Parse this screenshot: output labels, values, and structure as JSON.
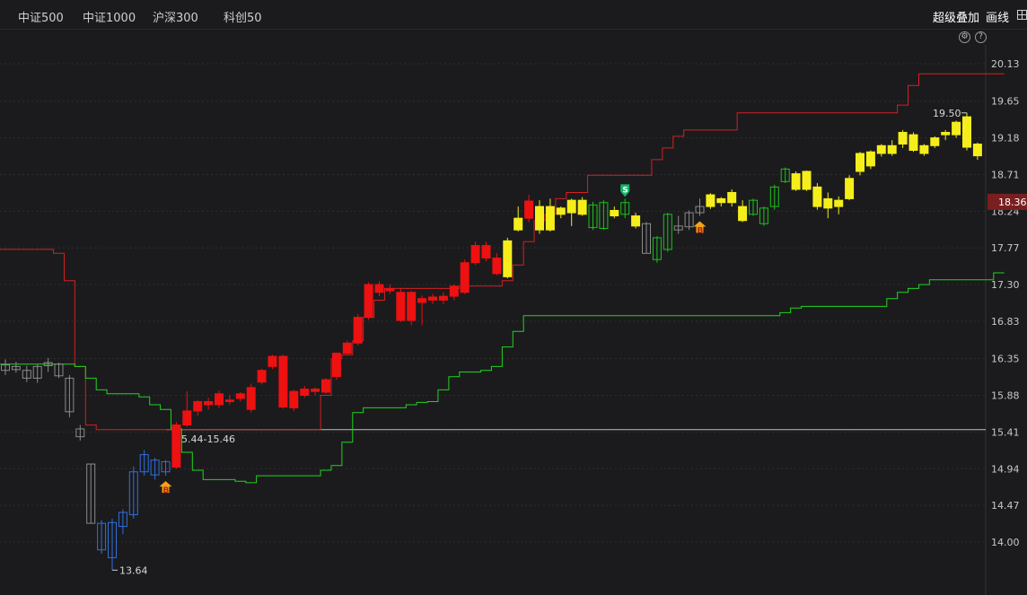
{
  "toolbar": {
    "tabs": [
      "中证500",
      "中证1000",
      "沪深300",
      "科创50"
    ],
    "overlay_label": "超级叠加",
    "draw_label": "画线"
  },
  "colors": {
    "background": "#1b1b1d",
    "up_red": "#ee1111",
    "yellow": "#f5ee1b",
    "green": "#18c418",
    "blue": "#2f6fe0",
    "gray": "#8a8a8a",
    "upper_band": "#d42020",
    "lower_band": "#1fd41f",
    "price_tag": "#7a1f1f"
  },
  "chart_data": {
    "type": "candlestick",
    "y_ticks": [
      "20.13",
      "19.65",
      "19.18",
      "18.71",
      "18.24",
      "17.77",
      "17.30",
      "16.83",
      "16.35",
      "15.88",
      "15.41",
      "14.94",
      "14.47",
      "14.00"
    ],
    "ylim": [
      13.55,
      20.25
    ],
    "current_price": "18.36",
    "reference_line": 15.44,
    "reference_label": "15.44-15.46",
    "max_label": "19.50",
    "max_value": 19.5,
    "min_label": "13.64",
    "min_value": 13.64,
    "candles": [
      {
        "o": 16.2,
        "h": 16.34,
        "l": 16.14,
        "c": 16.27,
        "s": "gray",
        "f": 0
      },
      {
        "o": 16.25,
        "h": 16.31,
        "l": 16.17,
        "c": 16.21,
        "s": "gray",
        "f": 0
      },
      {
        "o": 16.2,
        "h": 16.26,
        "l": 16.05,
        "c": 16.1,
        "s": "gray",
        "f": 0
      },
      {
        "o": 16.1,
        "h": 16.28,
        "l": 16.04,
        "c": 16.25,
        "s": "gray",
        "f": 0
      },
      {
        "o": 16.26,
        "h": 16.36,
        "l": 16.18,
        "c": 16.3,
        "s": "gray",
        "f": 0
      },
      {
        "o": 16.28,
        "h": 16.3,
        "l": 16.1,
        "c": 16.13,
        "s": "gray",
        "f": 0
      },
      {
        "o": 16.1,
        "h": 16.14,
        "l": 15.6,
        "c": 15.67,
        "s": "gray",
        "f": 0
      },
      {
        "o": 15.45,
        "h": 15.5,
        "l": 15.3,
        "c": 15.35,
        "s": "gray",
        "f": 0
      },
      {
        "o": 15.0,
        "h": 15.0,
        "l": 14.24,
        "c": 14.24,
        "s": "gray",
        "f": 0
      },
      {
        "o": 14.24,
        "h": 14.28,
        "l": 13.85,
        "c": 13.9,
        "s": "blue",
        "f": 0
      },
      {
        "o": 13.8,
        "h": 14.3,
        "l": 13.64,
        "c": 14.25,
        "s": "blue",
        "f": 0
      },
      {
        "o": 14.2,
        "h": 14.42,
        "l": 14.1,
        "c": 14.38,
        "s": "blue",
        "f": 0
      },
      {
        "o": 14.35,
        "h": 14.97,
        "l": 14.3,
        "c": 14.9,
        "s": "blue",
        "f": 0
      },
      {
        "o": 14.9,
        "h": 15.18,
        "l": 14.85,
        "c": 15.12,
        "s": "blue",
        "f": 0
      },
      {
        "o": 15.05,
        "h": 15.08,
        "l": 14.8,
        "c": 14.86,
        "s": "blue",
        "f": 0
      },
      {
        "o": 14.9,
        "h": 15.05,
        "l": 14.85,
        "c": 15.03,
        "s": "blue",
        "f": 0
      },
      {
        "o": 14.96,
        "h": 15.54,
        "l": 14.94,
        "c": 15.5,
        "s": "red",
        "f": 1
      },
      {
        "o": 15.5,
        "h": 15.93,
        "l": 15.48,
        "c": 15.68,
        "s": "red",
        "f": 1
      },
      {
        "o": 15.68,
        "h": 15.82,
        "l": 15.62,
        "c": 15.8,
        "s": "red",
        "f": 1
      },
      {
        "o": 15.8,
        "h": 15.85,
        "l": 15.7,
        "c": 15.76,
        "s": "red",
        "f": 1
      },
      {
        "o": 15.76,
        "h": 15.94,
        "l": 15.72,
        "c": 15.9,
        "s": "red",
        "f": 1
      },
      {
        "o": 15.82,
        "h": 15.88,
        "l": 15.76,
        "c": 15.8,
        "s": "red",
        "f": 1
      },
      {
        "o": 15.84,
        "h": 15.92,
        "l": 15.8,
        "c": 15.9,
        "s": "red",
        "f": 1
      },
      {
        "o": 15.7,
        "h": 16.03,
        "l": 15.66,
        "c": 15.98,
        "s": "red",
        "f": 1
      },
      {
        "o": 16.05,
        "h": 16.22,
        "l": 16.02,
        "c": 16.2,
        "s": "red",
        "f": 1
      },
      {
        "o": 16.25,
        "h": 16.4,
        "l": 16.22,
        "c": 16.38,
        "s": "red",
        "f": 1
      },
      {
        "o": 16.38,
        "h": 16.4,
        "l": 15.71,
        "c": 15.73,
        "s": "red",
        "f": 1
      },
      {
        "o": 15.72,
        "h": 15.95,
        "l": 15.68,
        "c": 15.93,
        "s": "red",
        "f": 1
      },
      {
        "o": 15.88,
        "h": 16.0,
        "l": 15.85,
        "c": 15.96,
        "s": "red",
        "f": 1
      },
      {
        "o": 15.93,
        "h": 15.98,
        "l": 15.88,
        "c": 15.96,
        "s": "red",
        "f": 1
      },
      {
        "o": 15.92,
        "h": 16.1,
        "l": 15.9,
        "c": 16.08,
        "s": "red",
        "f": 1
      },
      {
        "o": 16.12,
        "h": 16.43,
        "l": 16.08,
        "c": 16.42,
        "s": "red",
        "f": 1
      },
      {
        "o": 16.42,
        "h": 16.58,
        "l": 16.4,
        "c": 16.55,
        "s": "red",
        "f": 1
      },
      {
        "o": 16.55,
        "h": 16.92,
        "l": 16.52,
        "c": 16.88,
        "s": "red",
        "f": 1
      },
      {
        "o": 16.88,
        "h": 17.33,
        "l": 16.85,
        "c": 17.3,
        "s": "red",
        "f": 1
      },
      {
        "o": 17.2,
        "h": 17.34,
        "l": 17.15,
        "c": 17.3,
        "s": "red",
        "f": 1
      },
      {
        "o": 17.25,
        "h": 17.3,
        "l": 17.18,
        "c": 17.22,
        "s": "red",
        "f": 1
      },
      {
        "o": 17.2,
        "h": 17.25,
        "l": 16.82,
        "c": 16.84,
        "s": "red",
        "f": 1
      },
      {
        "o": 16.84,
        "h": 17.22,
        "l": 16.78,
        "c": 17.2,
        "s": "red",
        "f": 1
      },
      {
        "o": 17.07,
        "h": 17.16,
        "l": 16.78,
        "c": 17.12,
        "s": "red",
        "f": 1
      },
      {
        "o": 17.1,
        "h": 17.18,
        "l": 17.05,
        "c": 17.14,
        "s": "red",
        "f": 1
      },
      {
        "o": 17.1,
        "h": 17.2,
        "l": 17.05,
        "c": 17.15,
        "s": "red",
        "f": 1
      },
      {
        "o": 17.15,
        "h": 17.3,
        "l": 17.1,
        "c": 17.28,
        "s": "red",
        "f": 1
      },
      {
        "o": 17.2,
        "h": 17.62,
        "l": 17.18,
        "c": 17.58,
        "s": "red",
        "f": 1
      },
      {
        "o": 17.58,
        "h": 17.85,
        "l": 17.55,
        "c": 17.8,
        "s": "red",
        "f": 1
      },
      {
        "o": 17.8,
        "h": 17.85,
        "l": 17.6,
        "c": 17.64,
        "s": "red",
        "f": 1
      },
      {
        "o": 17.64,
        "h": 17.7,
        "l": 17.42,
        "c": 17.44,
        "s": "red",
        "f": 1
      },
      {
        "o": 17.4,
        "h": 17.9,
        "l": 17.38,
        "c": 17.86,
        "s": "yellow",
        "f": 1
      },
      {
        "o": 18.0,
        "h": 18.3,
        "l": 17.98,
        "c": 18.15,
        "s": "yellow",
        "f": 1
      },
      {
        "o": 18.15,
        "h": 18.45,
        "l": 18.1,
        "c": 18.37,
        "s": "red",
        "f": 1
      },
      {
        "o": 18.3,
        "h": 18.38,
        "l": 17.95,
        "c": 18.0,
        "s": "yellow",
        "f": 1
      },
      {
        "o": 18.3,
        "h": 18.4,
        "l": 17.98,
        "c": 18.0,
        "s": "yellow",
        "f": 1
      },
      {
        "o": 18.2,
        "h": 18.3,
        "l": 18.15,
        "c": 18.28,
        "s": "yellow",
        "f": 1
      },
      {
        "o": 18.22,
        "h": 18.4,
        "l": 18.05,
        "c": 18.38,
        "s": "yellow",
        "f": 1
      },
      {
        "o": 18.38,
        "h": 18.42,
        "l": 18.18,
        "c": 18.2,
        "s": "yellow",
        "f": 1
      },
      {
        "o": 18.32,
        "h": 18.36,
        "l": 18.0,
        "c": 18.03,
        "s": "green",
        "f": 0
      },
      {
        "o": 18.35,
        "h": 18.38,
        "l": 18.0,
        "c": 18.02,
        "s": "green",
        "f": 0
      },
      {
        "o": 18.18,
        "h": 18.3,
        "l": 18.15,
        "c": 18.25,
        "s": "yellow",
        "f": 1
      },
      {
        "o": 18.2,
        "h": 18.4,
        "l": 18.15,
        "c": 18.35,
        "s": "green",
        "f": 0
      },
      {
        "o": 18.18,
        "h": 18.22,
        "l": 18.02,
        "c": 18.05,
        "s": "yellow",
        "f": 1
      },
      {
        "o": 18.08,
        "h": 18.1,
        "l": 17.7,
        "c": 17.7,
        "s": "gray",
        "f": 0
      },
      {
        "o": 17.9,
        "h": 17.92,
        "l": 17.58,
        "c": 17.62,
        "s": "green",
        "f": 0
      },
      {
        "o": 17.75,
        "h": 18.22,
        "l": 17.72,
        "c": 18.2,
        "s": "green",
        "f": 0
      },
      {
        "o": 18.05,
        "h": 18.18,
        "l": 17.95,
        "c": 18.0,
        "s": "gray",
        "f": 0
      },
      {
        "o": 18.04,
        "h": 18.25,
        "l": 18.0,
        "c": 18.22,
        "s": "gray",
        "f": 0
      },
      {
        "o": 18.22,
        "h": 18.4,
        "l": 18.18,
        "c": 18.3,
        "s": "gray",
        "f": 0
      },
      {
        "o": 18.3,
        "h": 18.47,
        "l": 18.27,
        "c": 18.45,
        "s": "yellow",
        "f": 1
      },
      {
        "o": 18.35,
        "h": 18.42,
        "l": 18.3,
        "c": 18.4,
        "s": "yellow",
        "f": 1
      },
      {
        "o": 18.35,
        "h": 18.52,
        "l": 18.3,
        "c": 18.48,
        "s": "yellow",
        "f": 1
      },
      {
        "o": 18.3,
        "h": 18.38,
        "l": 18.1,
        "c": 18.12,
        "s": "yellow",
        "f": 1
      },
      {
        "o": 18.38,
        "h": 18.4,
        "l": 18.18,
        "c": 18.2,
        "s": "green",
        "f": 0
      },
      {
        "o": 18.08,
        "h": 18.3,
        "l": 18.05,
        "c": 18.28,
        "s": "green",
        "f": 0
      },
      {
        "o": 18.3,
        "h": 18.58,
        "l": 18.26,
        "c": 18.55,
        "s": "green",
        "f": 0
      },
      {
        "o": 18.62,
        "h": 18.8,
        "l": 18.6,
        "c": 18.78,
        "s": "green",
        "f": 0
      },
      {
        "o": 18.52,
        "h": 18.75,
        "l": 18.5,
        "c": 18.72,
        "s": "yellow",
        "f": 1
      },
      {
        "o": 18.75,
        "h": 18.76,
        "l": 18.5,
        "c": 18.52,
        "s": "yellow",
        "f": 1
      },
      {
        "o": 18.55,
        "h": 18.6,
        "l": 18.26,
        "c": 18.3,
        "s": "yellow",
        "f": 1
      },
      {
        "o": 18.4,
        "h": 18.48,
        "l": 18.15,
        "c": 18.28,
        "s": "yellow",
        "f": 1
      },
      {
        "o": 18.38,
        "h": 18.43,
        "l": 18.2,
        "c": 18.3,
        "s": "yellow",
        "f": 1
      },
      {
        "o": 18.4,
        "h": 18.7,
        "l": 18.38,
        "c": 18.66,
        "s": "yellow",
        "f": 1
      },
      {
        "o": 18.75,
        "h": 19.0,
        "l": 18.7,
        "c": 18.98,
        "s": "yellow",
        "f": 1
      },
      {
        "o": 18.82,
        "h": 19.02,
        "l": 18.78,
        "c": 19.0,
        "s": "yellow",
        "f": 1
      },
      {
        "o": 18.98,
        "h": 19.1,
        "l": 18.94,
        "c": 19.08,
        "s": "yellow",
        "f": 1
      },
      {
        "o": 19.08,
        "h": 19.15,
        "l": 18.95,
        "c": 18.98,
        "s": "yellow",
        "f": 1
      },
      {
        "o": 19.1,
        "h": 19.28,
        "l": 19.05,
        "c": 19.25,
        "s": "yellow",
        "f": 1
      },
      {
        "o": 19.22,
        "h": 19.25,
        "l": 19.0,
        "c": 19.02,
        "s": "yellow",
        "f": 1
      },
      {
        "o": 18.98,
        "h": 19.1,
        "l": 18.95,
        "c": 19.08,
        "s": "yellow",
        "f": 1
      },
      {
        "o": 19.08,
        "h": 19.2,
        "l": 19.05,
        "c": 19.18,
        "s": "yellow",
        "f": 1
      },
      {
        "o": 19.22,
        "h": 19.28,
        "l": 19.15,
        "c": 19.25,
        "s": "yellow",
        "f": 1
      },
      {
        "o": 19.22,
        "h": 19.4,
        "l": 19.18,
        "c": 19.38,
        "s": "yellow",
        "f": 1
      },
      {
        "o": 19.45,
        "h": 19.5,
        "l": 19.02,
        "c": 19.06,
        "s": "yellow",
        "f": 1
      },
      {
        "o": 19.1,
        "h": 19.12,
        "l": 18.9,
        "c": 18.95,
        "s": "yellow",
        "f": 1
      }
    ],
    "upper_band": [
      17.75,
      17.75,
      17.75,
      17.75,
      17.75,
      17.7,
      17.35,
      16.25,
      15.5,
      15.44,
      15.44,
      15.44,
      15.44,
      15.44,
      15.44,
      15.44,
      15.44,
      15.44,
      15.44,
      15.44,
      15.44,
      15.44,
      15.44,
      15.44,
      15.44,
      15.44,
      15.44,
      15.44,
      15.44,
      15.44,
      15.88,
      16.35,
      16.4,
      16.58,
      16.88,
      17.1,
      17.25,
      17.25,
      17.25,
      17.25,
      17.25,
      17.25,
      17.25,
      17.28,
      17.28,
      17.28,
      17.28,
      17.35,
      17.55,
      17.85,
      18.12,
      18.2,
      18.4,
      18.48,
      18.48,
      18.7,
      18.7,
      18.7,
      18.7,
      18.7,
      18.7,
      18.9,
      19.05,
      19.2,
      19.28,
      19.28,
      19.28,
      19.28,
      19.28,
      19.5,
      19.5,
      19.5,
      19.5,
      19.5,
      19.5,
      19.5,
      19.5,
      19.5,
      19.5,
      19.5,
      19.5,
      19.5,
      19.5,
      19.5,
      19.6,
      19.85,
      20.0,
      20.0,
      20.0,
      20.0,
      20.0,
      20.0,
      20.0,
      20.0
    ],
    "lower_band": [
      16.28,
      16.28,
      16.28,
      16.28,
      16.28,
      16.28,
      16.28,
      16.25,
      16.1,
      15.95,
      15.9,
      15.9,
      15.9,
      15.86,
      15.76,
      15.7,
      15.45,
      15.15,
      14.92,
      14.8,
      14.8,
      14.8,
      14.78,
      14.76,
      14.85,
      14.85,
      14.85,
      14.85,
      14.85,
      14.85,
      14.92,
      14.98,
      15.28,
      15.66,
      15.72,
      15.72,
      15.72,
      15.72,
      15.76,
      15.79,
      15.8,
      15.95,
      16.12,
      16.18,
      16.18,
      16.2,
      16.25,
      16.5,
      16.7,
      16.9,
      16.9,
      16.9,
      16.9,
      16.9,
      16.9,
      16.9,
      16.9,
      16.9,
      16.9,
      16.9,
      16.9,
      16.9,
      16.9,
      16.9,
      16.9,
      16.9,
      16.9,
      16.9,
      16.9,
      16.9,
      16.9,
      16.9,
      16.9,
      16.94,
      17.0,
      17.02,
      17.02,
      17.02,
      17.02,
      17.02,
      17.02,
      17.02,
      17.02,
      17.12,
      17.2,
      17.25,
      17.3,
      17.36,
      17.36,
      17.36,
      17.36,
      17.36,
      17.36,
      17.45
    ]
  },
  "markers": [
    {
      "candle": 15,
      "label": "B",
      "type": "buy"
    },
    {
      "candle": 58,
      "label": "S",
      "type": "sell"
    },
    {
      "candle": 65,
      "label": "B",
      "type": "buy"
    }
  ]
}
